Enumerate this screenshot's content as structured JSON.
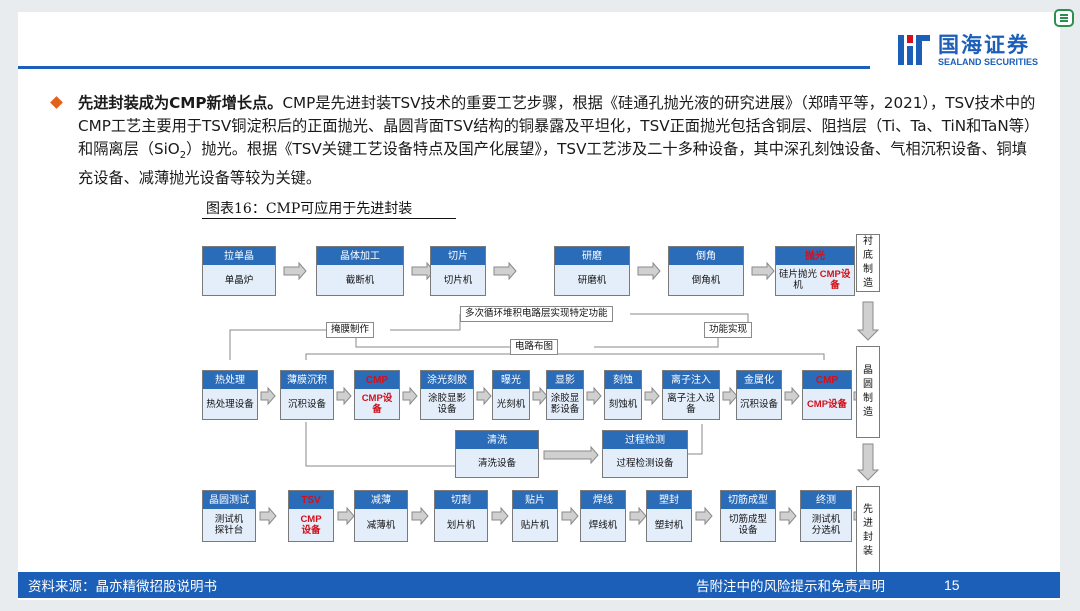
{
  "header": {
    "logo_cn": "国海证券",
    "logo_en": "SEALAND SECURITIES"
  },
  "bullet": {
    "bold_lead": "先进封装成为CMP新增长点。",
    "text_1": "CMP是先进封装TSV技术的重要工艺步骤，根据《硅通孔抛光液的研究进展》（郑晴平等，2021），TSV技术中的CMP工艺主要用于TSV铜淀积后的正面抛光、晶圆背面TSV结构的铜暴露及平坦化，TSV正面抛光包括含铜层、阻挡层（Ti、Ta、TiN和TaN等）和隔离层（SiO",
    "sub": "2",
    "text_2": "）抛光。根据《TSV关键工艺设备特点及国产化展望》，TSV工艺涉及二十多种设备，其中深孔刻蚀设备、气相沉积设备、铜填充设备、减薄抛光设备等较为关键。"
  },
  "figure": {
    "title": "图表16：CMP可应用于先进封装"
  },
  "diagram": {
    "row1": [
      {
        "head": "拉单晶",
        "body": "单晶炉"
      },
      {
        "head": "晶体加工",
        "body": "截断机"
      },
      {
        "head": "切片",
        "body": "切片机"
      },
      {
        "head": "研磨",
        "body": "研磨机"
      },
      {
        "head": "倒角",
        "body": "倒角机"
      },
      {
        "head": "抛光",
        "body": "硅片抛光机",
        "body_red": "CMP设备"
      }
    ],
    "row2": [
      {
        "head": "热处理",
        "body": "热处理设备"
      },
      {
        "head": "薄膜沉积",
        "body": "沉积设备"
      },
      {
        "head": "CMP",
        "body": "CMP设备"
      },
      {
        "head": "涂光刻胶",
        "body": "涂胶显影\n设备"
      },
      {
        "head": "曝光",
        "body": "光刻机"
      },
      {
        "head": "显影",
        "body": "涂胶显\n影设备"
      },
      {
        "head": "刻蚀",
        "body": "刻蚀机"
      },
      {
        "head": "离子注入",
        "body": "离子注入设备"
      },
      {
        "head": "金属化",
        "body": "沉积设备"
      },
      {
        "head": "CMP",
        "body": "CMP设备"
      }
    ],
    "row2b": [
      {
        "head": "清洗",
        "body": "清洗设备"
      },
      {
        "head": "过程检测",
        "body": "过程检测设备"
      }
    ],
    "row3": [
      {
        "head": "晶圆测试",
        "body": "测试机\n探针台"
      },
      {
        "head": "TSV",
        "body": "CMP\n设备"
      },
      {
        "head": "减薄",
        "body": "减薄机"
      },
      {
        "head": "切割",
        "body": "划片机"
      },
      {
        "head": "贴片",
        "body": "贴片机"
      },
      {
        "head": "焊线",
        "body": "焊线机"
      },
      {
        "head": "塑封",
        "body": "塑封机"
      },
      {
        "head": "切筋成型",
        "body": "切筋成型\n设备"
      },
      {
        "head": "终测",
        "body": "测试机\n分选机"
      }
    ],
    "side": [
      "衬\n底\n制\n造",
      "晶\n圆\n制\n造",
      "先\n进\n封\n装"
    ],
    "labels": {
      "multi": "多次循环堆积电路层实现特定功能",
      "mask": "掩膜制作",
      "func": "功能实现",
      "layout": "电路布图"
    }
  },
  "footer": {
    "source": "资料来源：晶亦精微招股说明书",
    "disclaimer": "告附注中的风险提示和免责声明",
    "page": "15"
  }
}
